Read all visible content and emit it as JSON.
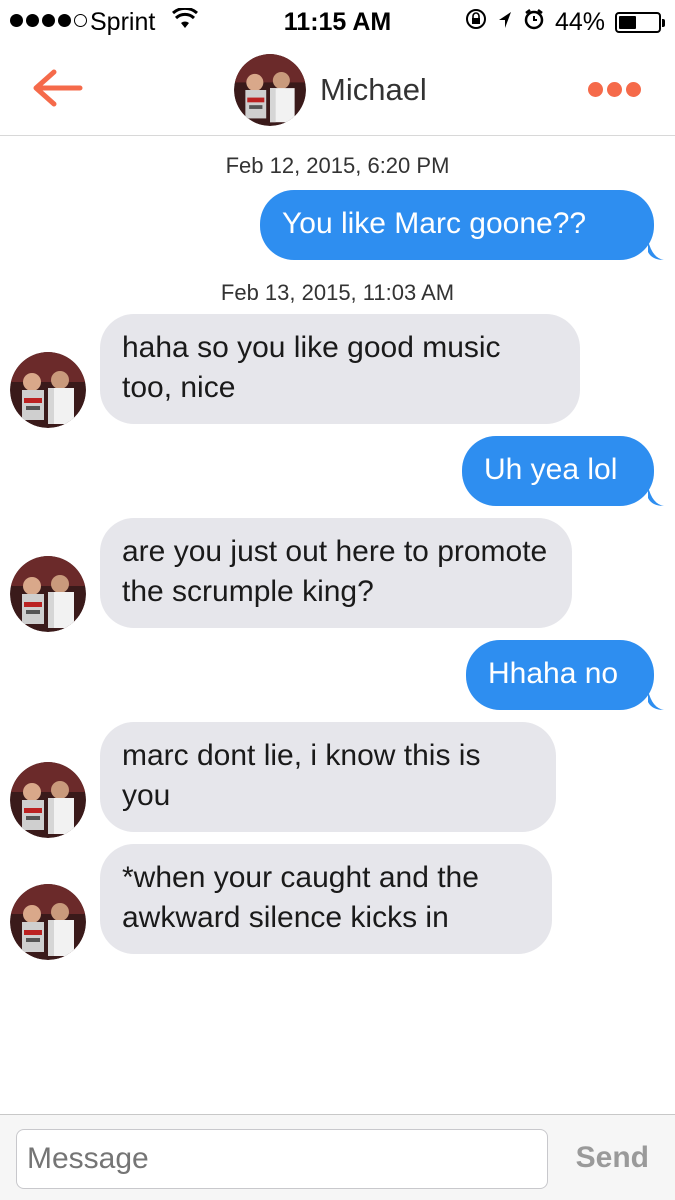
{
  "status": {
    "carrier": "Sprint",
    "time": "11:15 AM",
    "battery_percent": "44%",
    "battery_level": 0.44
  },
  "nav": {
    "back_icon": "arrow-left-icon",
    "contact_name": "Michael",
    "more_icon": "more-dots-icon",
    "accent_color": "#f56a4a"
  },
  "messages": {
    "ts1": "Feb 12, 2015, 6:20 PM",
    "m1": "You like Marc goone??",
    "ts2": "Feb 13, 2015, 11:03 AM",
    "m2": "haha so you like good music too, nice",
    "m3": "Uh yea lol",
    "m4": "are you just out here to promote the scrumple king?",
    "m5": "Hhaha no",
    "m6": "marc dont lie, i know this is you",
    "m7": "*when your caught and the awkward silence kicks in"
  },
  "composer": {
    "placeholder": "Message",
    "send_label": "Send"
  },
  "colors": {
    "outgoing": "#2e8ef0",
    "incoming": "#e6e6eb"
  }
}
